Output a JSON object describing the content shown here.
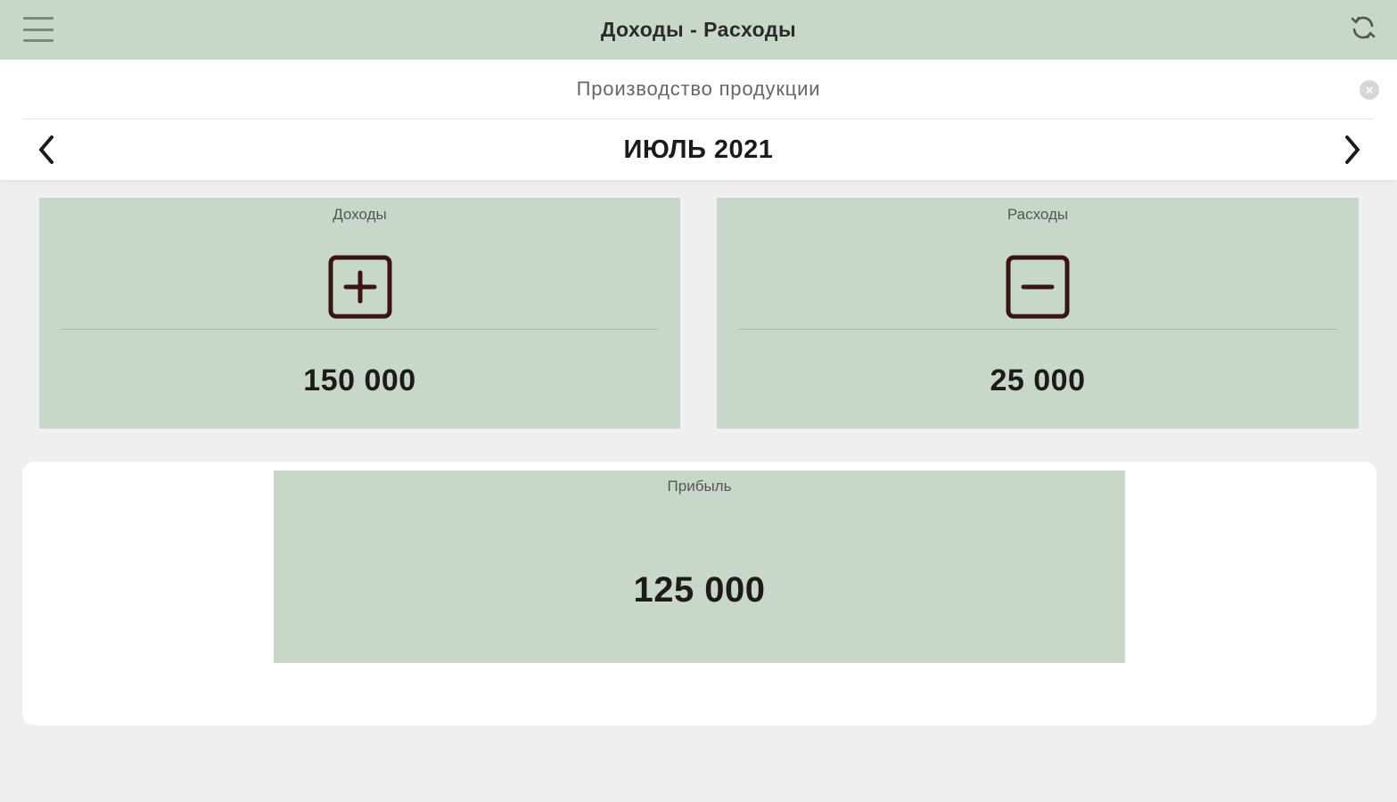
{
  "header": {
    "title": "Доходы - Расходы",
    "menu_icon": "hamburger-menu-icon",
    "sync_icon": "sync-icon"
  },
  "filter": {
    "search_value": "Производство продукции",
    "clear_icon": "clear-circle-icon"
  },
  "period": {
    "label": "ИЮЛЬ 2021",
    "prev_icon": "chevron-left-icon",
    "next_icon": "chevron-right-icon"
  },
  "income": {
    "label": "Доходы",
    "value": "150 000",
    "icon": "plus-square-icon"
  },
  "expense": {
    "label": "Расходы",
    "value": "25 000",
    "icon": "minus-square-icon"
  },
  "profit": {
    "label": "Прибыль",
    "value": "125 000"
  },
  "colors": {
    "accent_green": "#c8d8c8",
    "icon_brown": "#3a1414",
    "background": "#efefef"
  }
}
